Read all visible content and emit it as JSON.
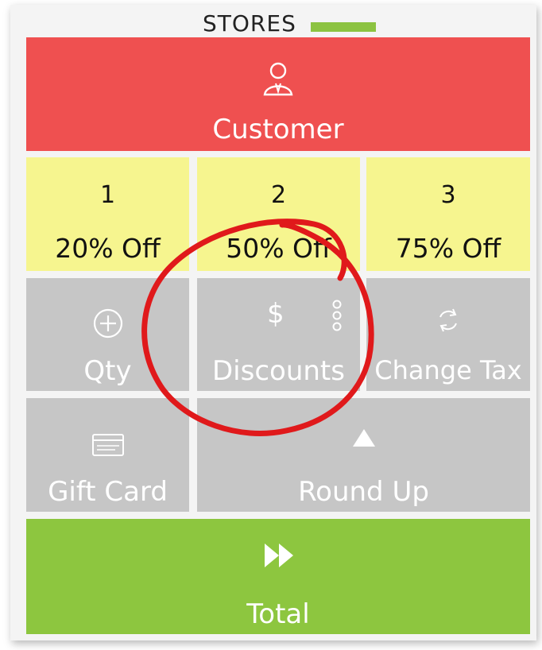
{
  "header": {
    "title": "STORES",
    "accent_color": "#8cc341"
  },
  "customer": {
    "label": "Customer",
    "icon": "user-icon",
    "color": "#ef5050"
  },
  "discount_presets": [
    {
      "number": "1",
      "label": "20% Off"
    },
    {
      "number": "2",
      "label": "50% Off"
    },
    {
      "number": "3",
      "label": "75% Off"
    }
  ],
  "actions": {
    "qty": {
      "label": "Qty",
      "icon": "plus-circle-icon"
    },
    "discounts": {
      "label": "Discounts",
      "icon": "dollar-icon",
      "more_icon": "more-vertical-icon"
    },
    "change_tax": {
      "label": "Change Tax",
      "icon": "refresh-icon"
    },
    "gift_card": {
      "label": "Gift Card",
      "icon": "gift-card-icon"
    },
    "round_up": {
      "label": "Round Up",
      "icon": "triangle-up-icon"
    }
  },
  "total": {
    "label": "Total",
    "icon": "fast-forward-icon",
    "color": "#8dc63f"
  },
  "colors": {
    "tile_gray": "#c6c6c6",
    "tile_yellow": "#f6f58f",
    "annotation_red": "#e0191b"
  }
}
